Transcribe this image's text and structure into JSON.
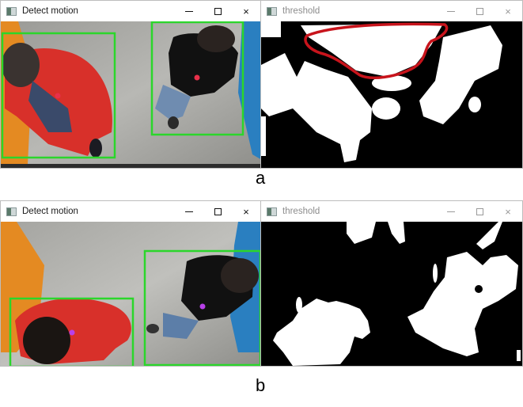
{
  "panel_a": {
    "label": "a",
    "detect_window": {
      "title": "Detect motion",
      "controls": {
        "minimize": "minimize-icon",
        "maximize": "maximize-icon",
        "close": "close-icon"
      },
      "bounding_box_color": "#2bd62b",
      "centroid_color": "#e8304a"
    },
    "threshold_window": {
      "title": "threshold",
      "controls": {
        "minimize": "minimize-icon",
        "maximize": "maximize-icon",
        "close": "close-icon"
      },
      "annotation_color": "#c8141c"
    }
  },
  "panel_b": {
    "label": "b",
    "detect_window": {
      "title": "Detect motion",
      "controls": {
        "minimize": "minimize-icon",
        "maximize": "maximize-icon",
        "close": "close-icon"
      },
      "bounding_box_color": "#2bd62b",
      "centroid_color": "#b840e8"
    },
    "threshold_window": {
      "title": "threshold",
      "controls": {
        "minimize": "minimize-icon",
        "maximize": "maximize-icon",
        "close": "close-icon"
      }
    }
  },
  "icons": {
    "close": "×"
  }
}
